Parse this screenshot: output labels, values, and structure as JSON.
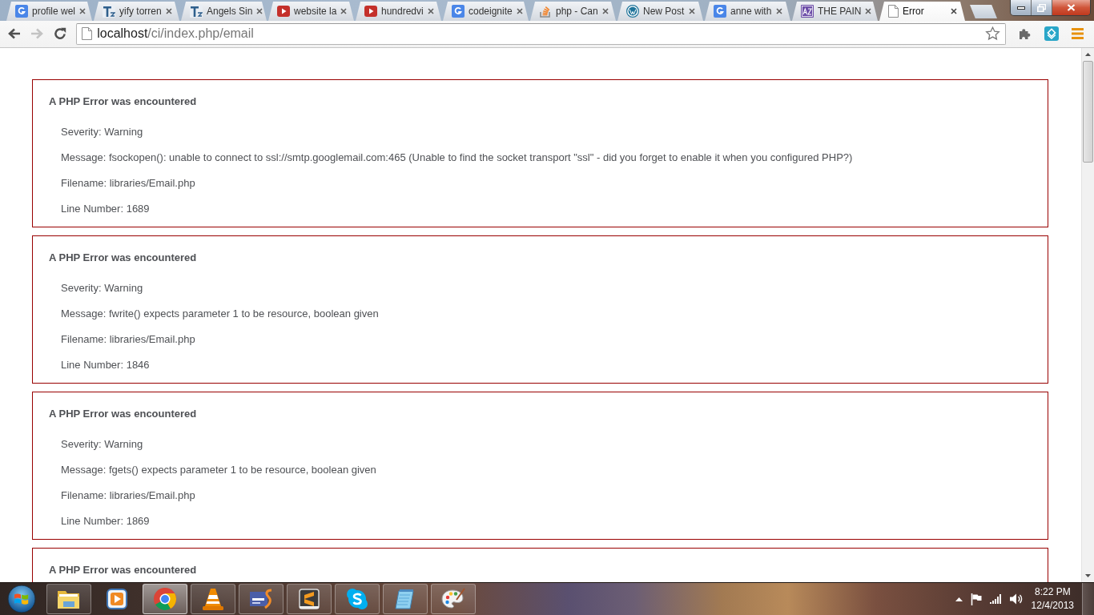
{
  "tabs": [
    {
      "title": "profile wel",
      "kind": "google",
      "selected": false
    },
    {
      "title": "yify torren",
      "kind": "tz",
      "selected": false
    },
    {
      "title": "Angels Sin",
      "kind": "tz",
      "selected": false
    },
    {
      "title": "website la",
      "kind": "video",
      "selected": false
    },
    {
      "title": "hundredvi",
      "kind": "video",
      "selected": false
    },
    {
      "title": "codeignite",
      "kind": "google",
      "selected": false
    },
    {
      "title": "php - Can",
      "kind": "stack",
      "selected": false
    },
    {
      "title": "New Post",
      "kind": "wp",
      "selected": false
    },
    {
      "title": "anne with",
      "kind": "google",
      "selected": false
    },
    {
      "title": "THE PAIN",
      "kind": "az",
      "selected": false
    },
    {
      "title": "Error",
      "kind": "page",
      "selected": true
    }
  ],
  "toolbar": {
    "nav": [
      {
        "kind": "back",
        "disabled": false
      },
      {
        "kind": "forward",
        "disabled": true
      },
      {
        "kind": "reload",
        "disabled": false
      }
    ],
    "address": {
      "host": "localhost",
      "path": "/ci/index.php/email"
    },
    "extensions": [
      {
        "kind": "puzzle"
      },
      {
        "kind": "diamond"
      },
      {
        "kind": "menu"
      }
    ]
  },
  "errors": [
    {
      "title": "A PHP Error was encountered",
      "lines": [
        "Severity: Warning",
        "Message: fsockopen(): unable to connect to ssl://smtp.googlemail.com:465 (Unable to find the socket transport \"ssl\" - did you forget to enable it when you configured PHP?)",
        "Filename: libraries/Email.php",
        "Line Number: 1689"
      ]
    },
    {
      "title": "A PHP Error was encountered",
      "lines": [
        "Severity: Warning",
        "Message: fwrite() expects parameter 1 to be resource, boolean given",
        "Filename: libraries/Email.php",
        "Line Number: 1846"
      ]
    },
    {
      "title": "A PHP Error was encountered",
      "lines": [
        "Severity: Warning",
        "Message: fgets() expects parameter 1 to be resource, boolean given",
        "Filename: libraries/Email.php",
        "Line Number: 1869"
      ]
    },
    {
      "title": "A PHP Error was encountered"
    }
  ],
  "taskbar": {
    "apps": [
      {
        "kind": "explorer",
        "running": true,
        "selected": false
      },
      {
        "kind": "mediaplayer",
        "running": false,
        "selected": false
      },
      {
        "kind": "chrome",
        "running": true,
        "selected": true
      },
      {
        "kind": "vlc",
        "running": true,
        "selected": false
      },
      {
        "kind": "phpide",
        "running": true,
        "selected": false
      },
      {
        "kind": "sublime",
        "running": true,
        "selected": false
      },
      {
        "kind": "skype",
        "running": true,
        "selected": false
      },
      {
        "kind": "notepad",
        "running": true,
        "selected": false
      },
      {
        "kind": "paint",
        "running": true,
        "selected": false
      }
    ],
    "clock": {
      "time": "8:22 PM",
      "date": "12/4/2013"
    }
  }
}
